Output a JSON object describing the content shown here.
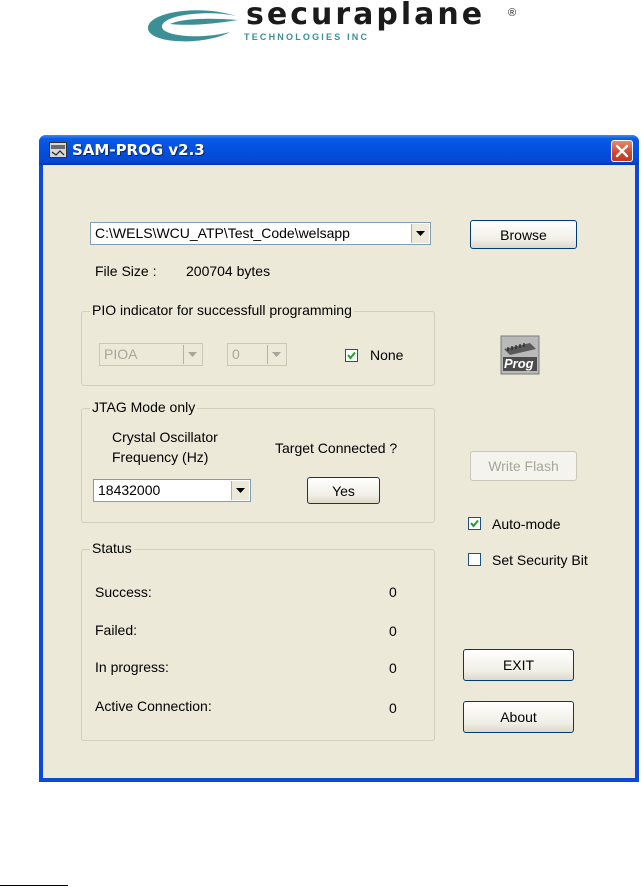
{
  "logo": {
    "brand": "securaplane",
    "subtitle": "TECHNOLOGIES INC",
    "registered": "®"
  },
  "window": {
    "title": "SAM-PROG v2.3",
    "icon": "app-icon",
    "close_icon": "close-icon"
  },
  "file": {
    "path": "C:\\WELS\\WCU_ATP\\Test_Code\\welsapp",
    "browse_label": "Browse",
    "size_label": "File Size :",
    "size_value": "200704 bytes"
  },
  "pio": {
    "group_title": "PIO indicator for successfull programming",
    "port_value": "PIOA",
    "pin_value": "0",
    "none_label": "None",
    "none_checked": true
  },
  "prog_icon_label": "Prog",
  "jtag": {
    "group_title": "JTAG Mode only",
    "osc_label_line1": "Crystal Oscillator",
    "osc_label_line2": "Frequency (Hz)",
    "osc_value": "18432000",
    "target_label": "Target Connected ?",
    "yes_label": "Yes"
  },
  "actions": {
    "write_flash_label": "Write Flash",
    "auto_mode_label": "Auto-mode",
    "auto_mode_checked": true,
    "security_bit_label": "Set Security Bit",
    "security_bit_checked": false,
    "exit_label": "EXIT",
    "about_label": "About"
  },
  "status": {
    "group_title": "Status",
    "rows": [
      {
        "label": "Success:",
        "value": "0"
      },
      {
        "label": "Failed:",
        "value": "0"
      },
      {
        "label": "In progress:",
        "value": "0"
      },
      {
        "label": "Active Connection:",
        "value": "0"
      }
    ]
  },
  "colors": {
    "titlebar": "#0450df",
    "client_bg": "#ece9d8",
    "close_button": "#d0452a",
    "logo_accent": "#3c8f95"
  }
}
